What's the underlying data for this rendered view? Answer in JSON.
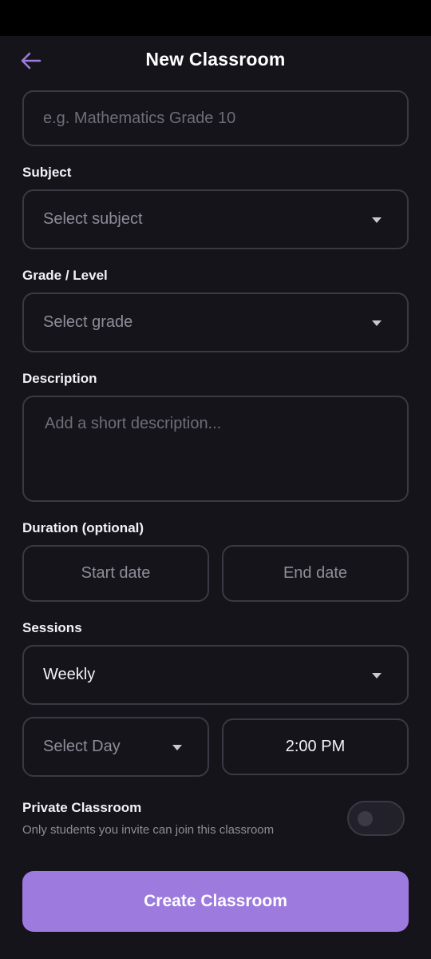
{
  "header": {
    "title": "New Classroom",
    "back_icon": "arrow-left-icon"
  },
  "colors": {
    "accent": "#9c7ade",
    "background": "#15141b",
    "border": "#3a3944"
  },
  "form": {
    "name_placeholder": "e.g. Mathematics Grade 10",
    "subject": {
      "label": "Subject",
      "value": "Select subject"
    },
    "grade": {
      "label": "Grade / Level",
      "value": "Select grade"
    },
    "description": {
      "label": "Description",
      "placeholder": "Add a short description..."
    },
    "duration": {
      "label": "Duration (optional)",
      "start": "Start date",
      "end": "End date"
    },
    "sessions": {
      "label": "Sessions",
      "frequency": "Weekly",
      "day": "Select Day",
      "time": "2:00 PM"
    },
    "private": {
      "title": "Private Classroom",
      "subtitle": "Only students you invite can join this classroom",
      "enabled": false
    },
    "submit_label": "Create Classroom"
  }
}
